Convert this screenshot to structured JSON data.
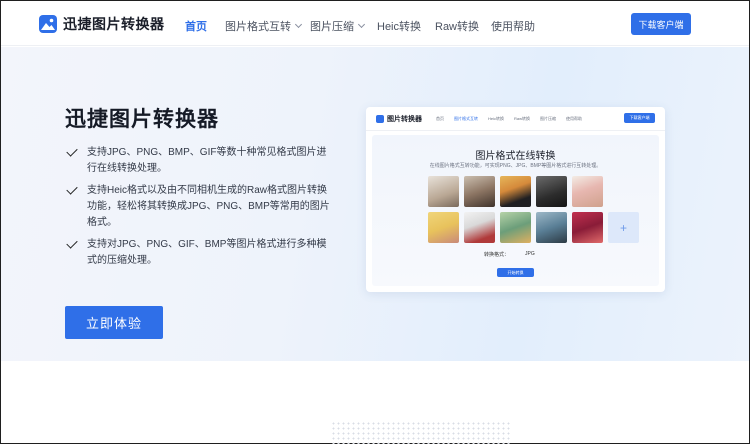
{
  "brand": {
    "name": "迅捷图片转换器"
  },
  "nav": {
    "items": [
      {
        "label": "首页",
        "active": true,
        "dropdown": false
      },
      {
        "label": "图片格式互转",
        "active": false,
        "dropdown": true
      },
      {
        "label": "图片压缩",
        "active": false,
        "dropdown": true
      },
      {
        "label": "Heic转换",
        "active": false,
        "dropdown": false
      },
      {
        "label": "Raw转换",
        "active": false,
        "dropdown": false
      },
      {
        "label": "使用帮助",
        "active": false,
        "dropdown": false
      }
    ],
    "download_label": "下载客户端"
  },
  "hero": {
    "title": "迅捷图片转换器",
    "features": [
      "支持JPG、PNG、BMP、GIF等数十种常见格式图片进行在线转换处理。",
      "支持Heic格式以及由不同相机生成的Raw格式图片转换功能，轻松将其转换成JPG、PNG、BMP等常用的图片格式。",
      "支持对JPG、PNG、GIF、BMP等图片格式进行多种模式的压缩处理。"
    ],
    "cta_label": "立即体验"
  },
  "mockup": {
    "logo": "图片转换器",
    "nav": [
      "首页",
      "图片格式互转",
      "Heic转换",
      "Raw转换",
      "图片压缩",
      "使用帮助"
    ],
    "download_label": "下载客户端",
    "title": "图片格式在线转换",
    "subtitle": "在线图片格式互转功能，可实现PNG、JPG、BMP等图片格式进行互转处理。",
    "format_label": "转换格式：",
    "format_value": "JPG",
    "start_label": "开始转换",
    "add_symbol": "+"
  },
  "colors": {
    "accent": "#2f6fe8",
    "hero_bg_start": "#f3f5fb",
    "hero_bg_end": "#e2eefc"
  }
}
